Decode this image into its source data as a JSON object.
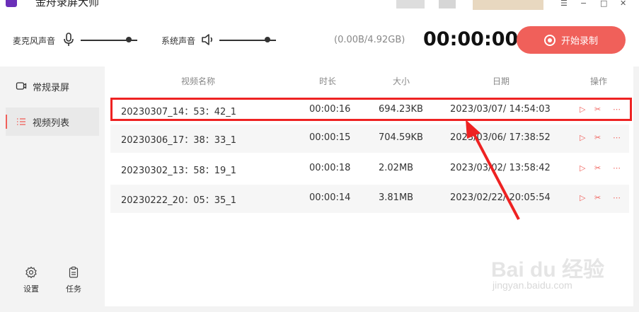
{
  "app": {
    "title": "金舟录屏大师"
  },
  "window_controls": {
    "menu": "☰",
    "minimize": "−",
    "maximize": "□",
    "close": "✕"
  },
  "controls": {
    "mic_label": "麦克风声音",
    "system_label": "系统声音",
    "mic_volume": 0.85,
    "system_volume": 0.85,
    "storage": "(0.00B/4.92GB)",
    "timer": "00:00:00",
    "record_label": "开始录制"
  },
  "sidebar": {
    "items": [
      {
        "label": "常规录屏",
        "icon": "screen-record-icon",
        "active": false
      },
      {
        "label": "视频列表",
        "icon": "list-icon",
        "active": true
      }
    ],
    "bottom": [
      {
        "label": "设置",
        "icon": "gear-icon"
      },
      {
        "label": "任务",
        "icon": "task-icon"
      }
    ]
  },
  "table": {
    "headers": {
      "name": "视频名称",
      "duration": "时长",
      "size": "大小",
      "date": "日期",
      "actions": "操作"
    },
    "rows": [
      {
        "name": "20230307_14：53：42_1",
        "duration": "00:00:16",
        "size": "694.23KB",
        "date": "2023/03/07/ 14:54:03"
      },
      {
        "name": "20230306_17：38：33_1",
        "duration": "00:00:15",
        "size": "704.59KB",
        "date": "2023/03/06/ 17:38:52"
      },
      {
        "name": "20230302_13：58：19_1",
        "duration": "00:00:18",
        "size": "2.02MB",
        "date": "2023/03/02/ 13:58:42"
      },
      {
        "name": "20230222_20：05：35_1",
        "duration": "00:00:14",
        "size": "3.81MB",
        "date": "2023/02/22/ 20:05:54"
      }
    ],
    "action_icons": [
      "play-icon",
      "scissors-icon",
      "more-icon"
    ],
    "action_glyphs": {
      "play": "▷",
      "cut": "✂",
      "more": "⋯"
    }
  },
  "watermark": {
    "brand": "Bai du 经验",
    "url": "jingyan.baidu.com"
  },
  "colors": {
    "accent": "#f0605a",
    "highlight": "#e22222"
  }
}
